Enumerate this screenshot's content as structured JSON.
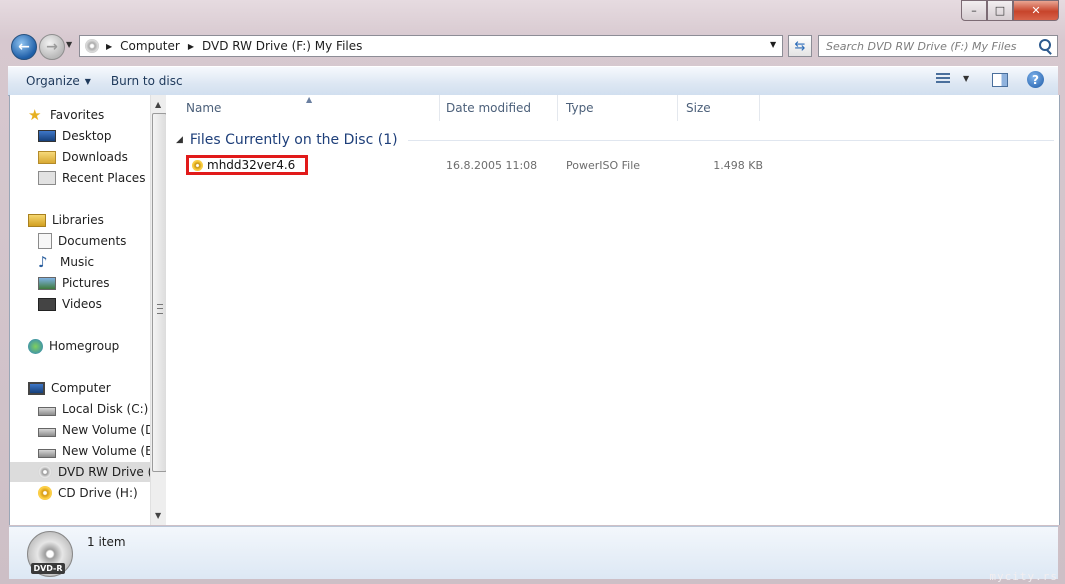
{
  "window": {
    "caption": {
      "minimize": "–",
      "maximize": "□",
      "close": "✕"
    }
  },
  "nav": {
    "back_icon": "back-arrow-icon",
    "forward_icon": "forward-arrow-icon",
    "breadcrumb": [
      "Computer",
      "DVD RW Drive (F:) My Files"
    ],
    "search_placeholder": "Search DVD RW Drive (F:) My Files"
  },
  "toolbar": {
    "organize": "Organize",
    "burn": "Burn to disc",
    "help": "?"
  },
  "sidebar": {
    "favorites": {
      "label": "Favorites",
      "items": [
        "Desktop",
        "Downloads",
        "Recent Places"
      ]
    },
    "libraries": {
      "label": "Libraries",
      "items": [
        "Documents",
        "Music",
        "Pictures",
        "Videos"
      ]
    },
    "homegroup": {
      "label": "Homegroup"
    },
    "computer": {
      "label": "Computer",
      "items": [
        "Local Disk (C:)",
        "New Volume (D:)",
        "New Volume (E:)",
        "DVD RW Drive (F:)",
        "CD Drive (H:)"
      ]
    },
    "selected": "DVD RW Drive (F:)"
  },
  "columns": {
    "name": "Name",
    "date": "Date modified",
    "type": "Type",
    "size": "Size"
  },
  "group": {
    "label": "Files Currently on the Disc (1)"
  },
  "files": [
    {
      "name": "mhdd32ver4.6",
      "date": "16.8.2005 11:08",
      "type": "PowerISO File",
      "size": "1.498 KB"
    }
  ],
  "details": {
    "count": "1 item",
    "drive_label": "DVD-R"
  },
  "watermark": "mycity.rs",
  "colors": {
    "highlight_box": "#e11a1a",
    "group_header": "#1e3f7a"
  }
}
